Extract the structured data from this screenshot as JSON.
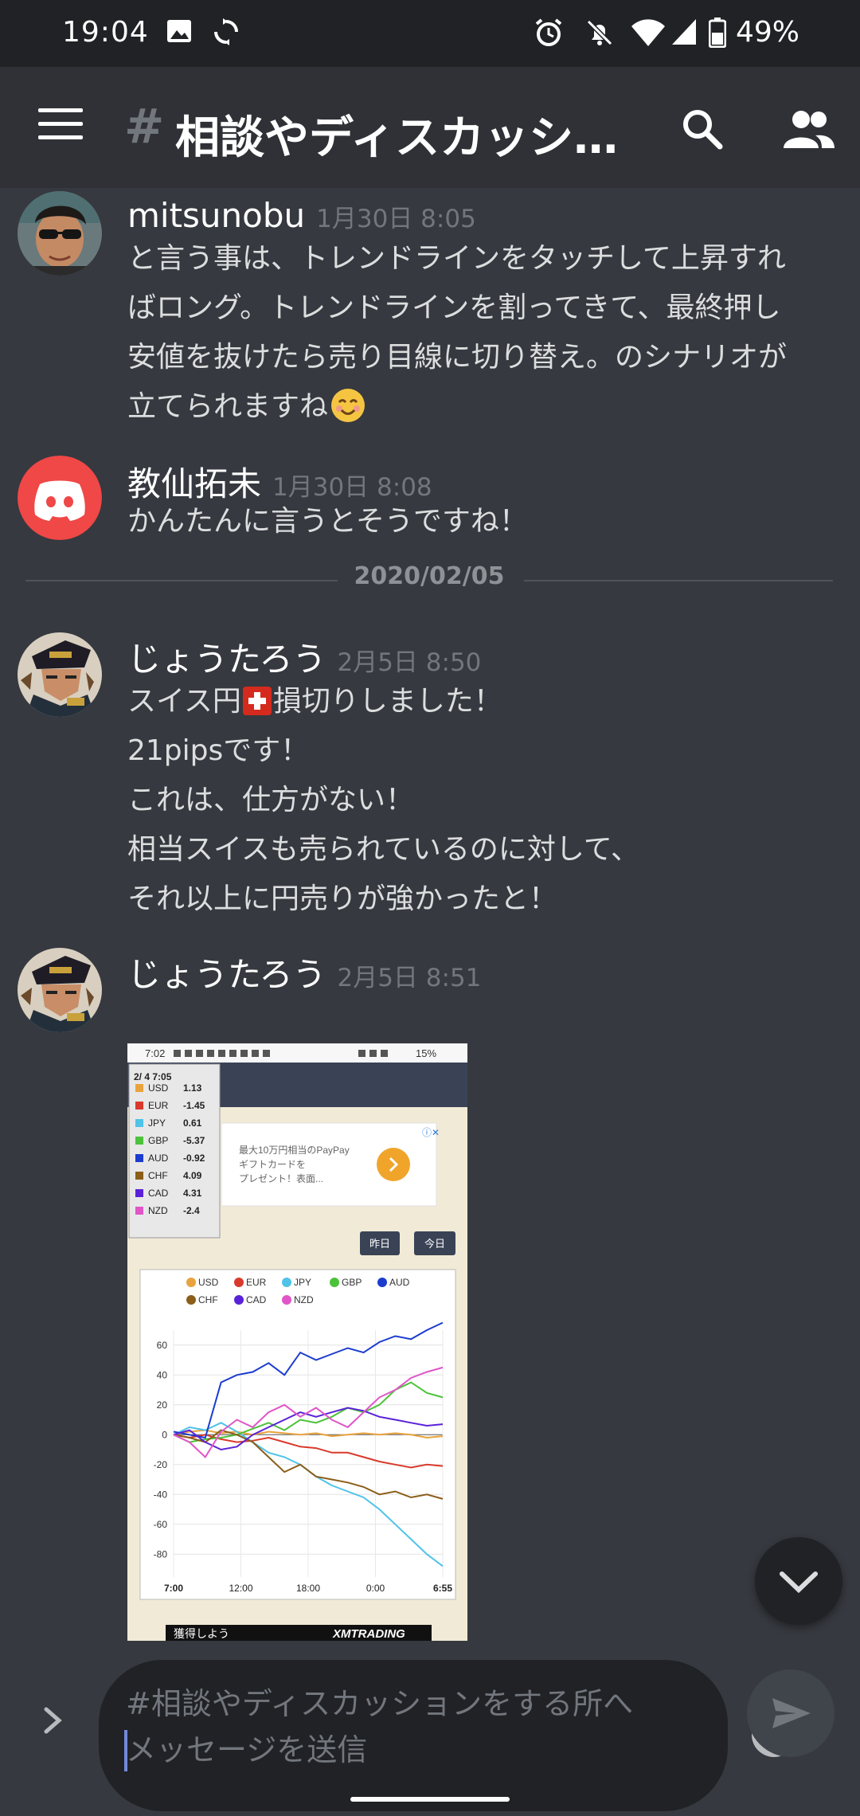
{
  "status_bar": {
    "time": "19:04",
    "battery": "49%"
  },
  "header": {
    "hash": "#",
    "channel_title": "相談やディスカッショ..."
  },
  "messages": [
    {
      "author": "mitsunobu",
      "timestamp": "1月30日 8:05",
      "lines": [
        "と言う事は、トレンドラインをタッチして上昇すれ",
        "ばロング。トレンドラインを割ってきて、最終押し",
        "安値を抜けたら売り目線に切り替え。のシナリオが",
        "立てられますね"
      ]
    },
    {
      "author": "教仙拓未",
      "timestamp": "1月30日 8:08",
      "lines": [
        "かんたんに言うとそうですね！"
      ]
    },
    {
      "author": "じょうたろう",
      "timestamp": "2月5日 8:50",
      "lines": [
        "スイス円",
        "損切りしました！",
        "21pipsです！",
        "これは、仕方がない！",
        "相当スイスも売られているのに対して、",
        "それ以上に円売りが強かったと！"
      ]
    },
    {
      "author": "じょうたろう",
      "timestamp": "2月5日 8:51"
    }
  ],
  "date_divider": "2020/02/05",
  "attachment": {
    "phone_time": "7:02",
    "phone_battery": "15%",
    "tooltip_date": "2/ 4 7:05",
    "currency_table": [
      {
        "code": "USD",
        "value": "1.13",
        "color": "#e8a33d"
      },
      {
        "code": "EUR",
        "value": "-1.45",
        "color": "#d93a2b"
      },
      {
        "code": "JPY",
        "value": "0.61",
        "color": "#4fc3e8"
      },
      {
        "code": "GBP",
        "value": "-5.37",
        "color": "#4cc23a"
      },
      {
        "code": "AUD",
        "value": "-0.92",
        "color": "#1c3ccf"
      },
      {
        "code": "CHF",
        "value": "4.09",
        "color": "#8b5e1a"
      },
      {
        "code": "CAD",
        "value": "4.31",
        "color": "#5a22d8"
      },
      {
        "code": "NZD",
        "value": "-2.4",
        "color": "#e055c8"
      }
    ],
    "ad_text_1": "最大10万円相当のPayPay",
    "ad_text_2": "ギフトカードを",
    "ad_text_3": "プレゼント！表面...",
    "btn_yesterday": "昨日",
    "btn_today": "今日",
    "bottom_banner_left": "獲得しよう",
    "bottom_banner_right": "XMTRADING"
  },
  "chart_data": {
    "type": "line",
    "x_ticks": [
      "7:00",
      "12:00",
      "18:00",
      "0:00",
      "6:55"
    ],
    "y_ticks": [
      60,
      40,
      20,
      0,
      -20,
      -40,
      -60,
      -80
    ],
    "ylim": [
      -90,
      70
    ],
    "legend": [
      "USD",
      "EUR",
      "JPY",
      "GBP",
      "AUD",
      "CHF",
      "CAD",
      "NZD"
    ],
    "series": [
      {
        "name": "USD",
        "color": "#e8a33d",
        "values": [
          0,
          2,
          3,
          1,
          2,
          0,
          2,
          1,
          0,
          1,
          -1,
          0,
          1,
          0,
          1,
          0,
          -2,
          -1
        ]
      },
      {
        "name": "EUR",
        "color": "#d93a2b",
        "values": [
          0,
          -2,
          0,
          -3,
          -5,
          -4,
          -2,
          -5,
          -8,
          -9,
          -12,
          -12,
          -15,
          -18,
          -20,
          -22,
          -20,
          -21
        ]
      },
      {
        "name": "JPY",
        "color": "#4fc3e8",
        "values": [
          0,
          5,
          3,
          8,
          2,
          -5,
          -12,
          -15,
          -20,
          -28,
          -34,
          -38,
          -42,
          -50,
          -60,
          -70,
          -80,
          -88
        ]
      },
      {
        "name": "GBP",
        "color": "#4cc23a",
        "values": [
          0,
          -5,
          -3,
          -2,
          0,
          4,
          8,
          3,
          10,
          8,
          12,
          18,
          15,
          20,
          30,
          35,
          28,
          25
        ]
      },
      {
        "name": "AUD",
        "color": "#1c3ccf",
        "values": [
          2,
          0,
          -2,
          35,
          40,
          42,
          48,
          40,
          55,
          50,
          54,
          58,
          55,
          62,
          66,
          64,
          70,
          75
        ]
      },
      {
        "name": "CHF",
        "color": "#8b5e1a",
        "values": [
          0,
          -2,
          -5,
          3,
          0,
          -5,
          -15,
          -25,
          -20,
          -28,
          -30,
          -32,
          -35,
          -40,
          -38,
          -42,
          -40,
          -43
        ]
      },
      {
        "name": "CAD",
        "color": "#5a22d8",
        "values": [
          0,
          3,
          -5,
          -10,
          -8,
          0,
          5,
          10,
          15,
          12,
          15,
          18,
          16,
          12,
          10,
          8,
          6,
          7
        ]
      },
      {
        "name": "NZD",
        "color": "#e055c8",
        "values": [
          0,
          -5,
          -15,
          2,
          10,
          5,
          15,
          20,
          12,
          18,
          10,
          5,
          15,
          25,
          30,
          38,
          42,
          45
        ]
      }
    ]
  }
}
